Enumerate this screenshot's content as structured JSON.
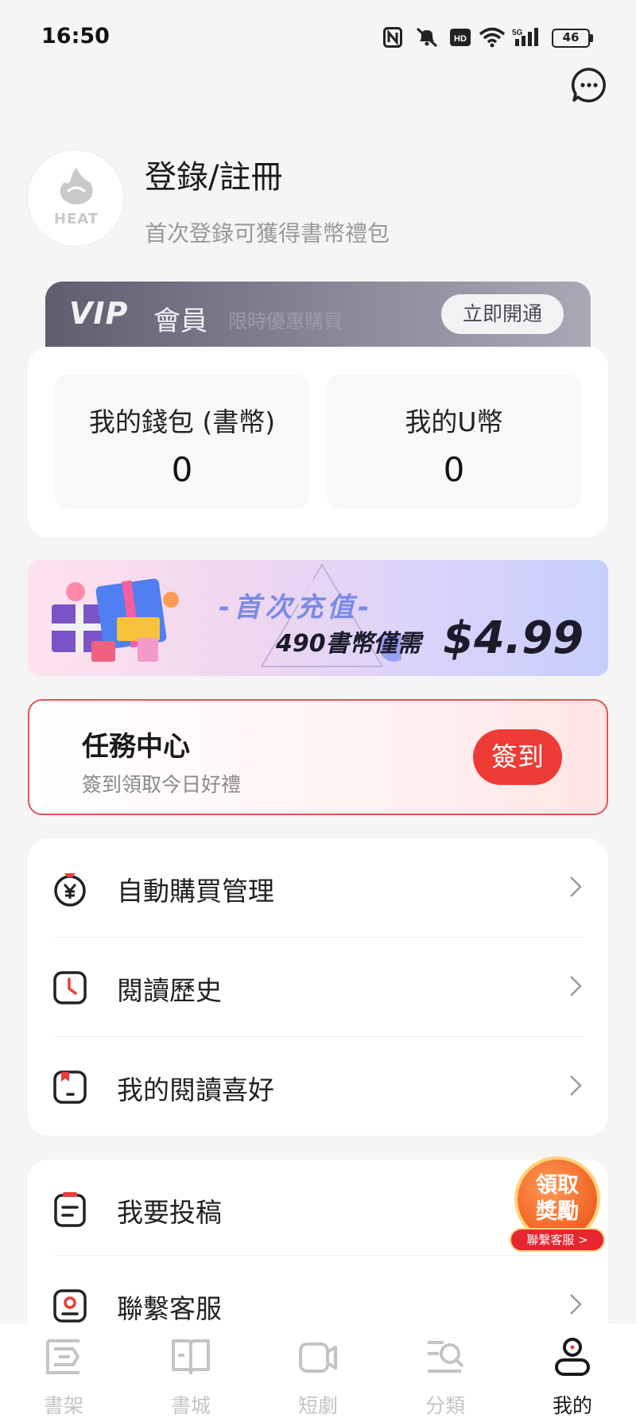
{
  "status_bar": {
    "time": "16:50",
    "battery": "46",
    "icons": [
      "nfc-icon",
      "mute-icon",
      "hd-icon",
      "wifi-icon",
      "signal-5g-icon"
    ]
  },
  "header": {
    "message_icon": "chat-bubble-icon"
  },
  "profile": {
    "avatar_text": "HEAT",
    "title": "登錄/註冊",
    "subtitle": "首次登錄可獲得書幣禮包"
  },
  "vip": {
    "logo": "VIP",
    "member": "會員",
    "promo": "限時優惠購買",
    "button": "立即開通"
  },
  "wallet": {
    "coins_label": "我的錢包 (書幣)",
    "coins_value": "0",
    "u_label": "我的U幣",
    "u_value": "0"
  },
  "promo_banner": {
    "title": "-首次充值-",
    "line": "490書幣僅需",
    "price": "$4.99"
  },
  "task_center": {
    "title": "任務中心",
    "subtitle": "簽到領取今日好禮",
    "button": "簽到"
  },
  "menu_1": [
    {
      "label": "自動購買管理",
      "icon": "yen-bag-icon"
    },
    {
      "label": "閱讀歷史",
      "icon": "clock-icon"
    },
    {
      "label": "我的閱讀喜好",
      "icon": "bookmark-icon"
    }
  ],
  "menu_2": [
    {
      "label": "我要投稿",
      "icon": "document-icon"
    },
    {
      "label": "聯繫客服",
      "icon": "contact-card-icon"
    }
  ],
  "reward_badge": {
    "text": "領取\n獎勵",
    "pill": "聯繫客服 >"
  },
  "bottom_nav": [
    {
      "label": "書架",
      "icon": "bookshelf-icon",
      "active": false
    },
    {
      "label": "書城",
      "icon": "open-book-icon",
      "active": false
    },
    {
      "label": "短劇",
      "icon": "video-icon",
      "active": false
    },
    {
      "label": "分類",
      "icon": "category-search-icon",
      "active": false
    },
    {
      "label": "我的",
      "icon": "person-icon",
      "active": true
    }
  ],
  "colors": {
    "accent_red": "#ee3b36",
    "vip_gray": "#6f6e7e",
    "page_bg": "#f5f5f5"
  }
}
